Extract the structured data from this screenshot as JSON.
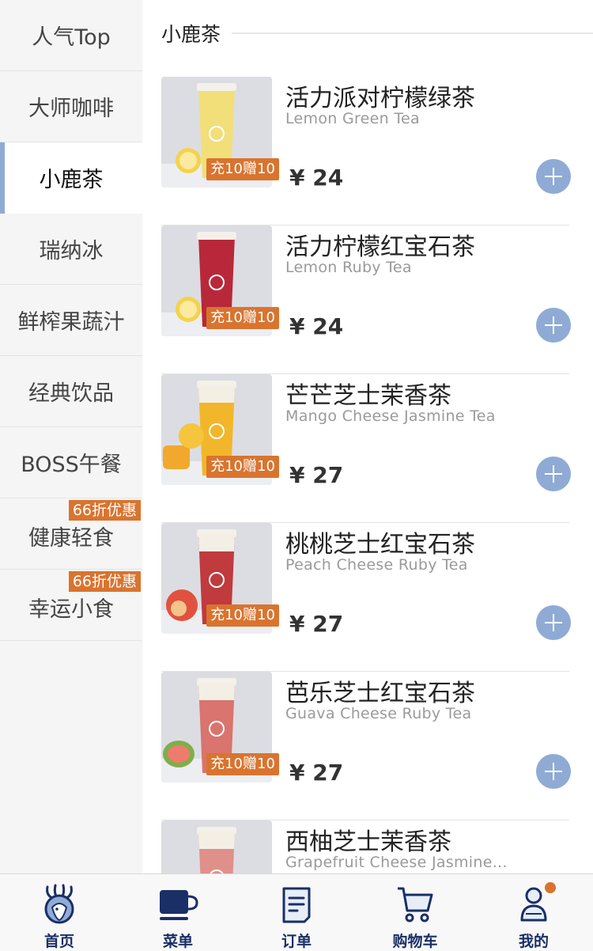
{
  "sidebar": {
    "categories": [
      {
        "label": "人气Top"
      },
      {
        "label": "大师咖啡"
      },
      {
        "label": "小鹿茶"
      },
      {
        "label": "瑞纳冰"
      },
      {
        "label": "鲜榨果蔬汁"
      },
      {
        "label": "经典饮品"
      },
      {
        "label": "BOSS午餐"
      },
      {
        "label": "健康轻食",
        "badge": "66折优惠"
      },
      {
        "label": "幸运小食",
        "badge": "66折优惠"
      }
    ],
    "active": "小鹿茶"
  },
  "main": {
    "section_title": "小鹿茶",
    "products": [
      {
        "name": "活力派对柠檬绿茶",
        "en": "Lemon Green Tea",
        "price": "¥ 24",
        "promo": "充10赠10",
        "drink_color": "#f2df7a",
        "fruit": "lemon"
      },
      {
        "name": "活力柠檬红宝石茶",
        "en": "Lemon Ruby Tea",
        "price": "¥ 24",
        "promo": "充10赠10",
        "drink_color": "#b8283a",
        "fruit": "lemon"
      },
      {
        "name": "芒芒芝士茉香茶",
        "en": "Mango Cheese Jasmine Tea",
        "price": "¥ 27",
        "promo": "充10赠10",
        "drink_color": "#f2b62a",
        "fruit": "mango"
      },
      {
        "name": "桃桃芝士红宝石茶",
        "en": "Peach Cheese Ruby Tea",
        "price": "¥ 27",
        "promo": "充10赠10",
        "drink_color": "#c03a3e",
        "fruit": "peach"
      },
      {
        "name": "芭乐芝士红宝石茶",
        "en": "Guava Cheese Ruby Tea",
        "price": "¥ 27",
        "promo": "充10赠10",
        "drink_color": "#d9746e",
        "fruit": "guava"
      },
      {
        "name": "西柚芝士茉香茶",
        "en": "Grapefruit Cheese Jasmine...",
        "drink_color": "#e0908a",
        "fruit": "none"
      }
    ]
  },
  "tabbar": {
    "tabs": [
      {
        "label": "首页",
        "icon": "deer-logo-icon"
      },
      {
        "label": "菜单",
        "icon": "coffee-cup-icon"
      },
      {
        "label": "订单",
        "icon": "order-list-icon"
      },
      {
        "label": "购物车",
        "icon": "cart-icon"
      },
      {
        "label": "我的",
        "icon": "profile-icon"
      }
    ]
  },
  "colors": {
    "accent": "#90abd6",
    "badge": "#d9742f",
    "tab_text": "#1a2f66"
  }
}
